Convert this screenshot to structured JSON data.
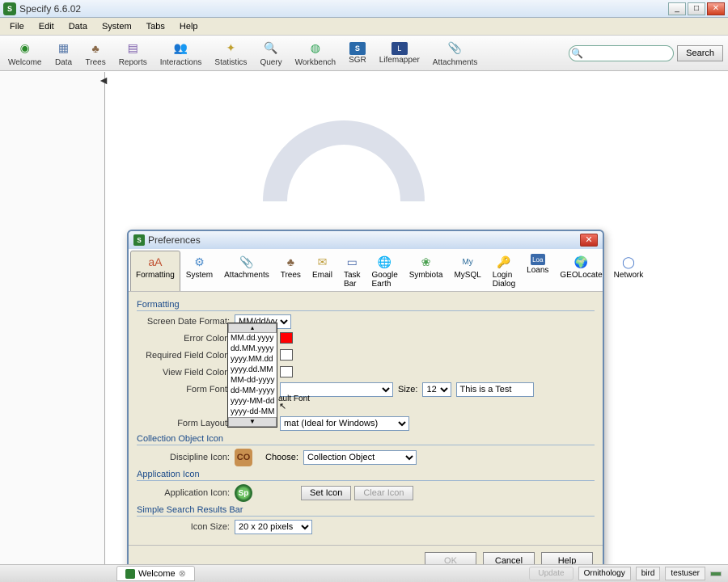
{
  "app": {
    "title": "Specify 6.6.02",
    "icon_initial": "S"
  },
  "menu": {
    "file": "File",
    "edit": "Edit",
    "data": "Data",
    "system": "System",
    "tabs": "Tabs",
    "help": "Help"
  },
  "toolbar": {
    "welcome": "Welcome",
    "data": "Data",
    "trees": "Trees",
    "reports": "Reports",
    "interactions": "Interactions",
    "statistics": "Statistics",
    "query": "Query",
    "workbench": "Workbench",
    "sgr": "SGR",
    "lifemapper": "Lifemapper",
    "attachments": "Attachments",
    "search_placeholder": "",
    "search_button": "Search"
  },
  "dialog": {
    "title": "Preferences",
    "tabs": [
      "Formatting",
      "System",
      "Attachments",
      "Trees",
      "Email",
      "Task Bar",
      "Google Earth",
      "Symbiota",
      "MySQL",
      "Login Dialog",
      "Loans",
      "GEOLocate",
      "Network"
    ],
    "active_tab": "Formatting",
    "section_formatting": "Formatting",
    "screen_date_format_label": "Screen Date Format:",
    "screen_date_format_value": "MM/dd/yyyy",
    "date_options": [
      "MM.dd.yyyy",
      "dd.MM.yyyy",
      "yyyy.MM.dd",
      "yyyy.dd.MM",
      "MM-dd-yyyy",
      "dd-MM-yyyy",
      "yyyy-MM-dd",
      "yyyy-dd-MM"
    ],
    "date_options_more_label": "▼",
    "error_color_label": "Error Color:",
    "error_color_value": "#ff0000",
    "required_field_color_label": "Required Field Color:",
    "required_field_color_value": "#ffffff",
    "view_field_color_label": "View Field Color:",
    "view_field_color_value": "#ffffff",
    "form_font_label": "Form Font:",
    "form_font_value": "",
    "size_label": "Size:",
    "size_value": "12",
    "sample_text": "This is a Test",
    "default_font_fragment": "ault Font",
    "form_layout_label": "Form Layout:",
    "form_layout_value": "mat (Ideal for Windows)",
    "section_collection": "Collection Object Icon",
    "discipline_icon_label": "Discipline Icon:",
    "discipline_icon_text": "CO",
    "choose_label": "Choose:",
    "choose_value": "Collection Object",
    "section_appicon": "Application Icon",
    "application_icon_label": "Application Icon:",
    "set_icon_button": "Set Icon",
    "clear_icon_button": "Clear Icon",
    "section_search": "Simple Search Results Bar",
    "icon_size_label": "Icon Size:",
    "icon_size_value": "20 x 20 pixels",
    "ok": "OK",
    "cancel": "Cancel",
    "help": "Help"
  },
  "statusbar": {
    "welcome_tab": "Welcome",
    "update_button": "Update",
    "item1": "Ornithology",
    "item2": "bird",
    "item3": "testuser"
  }
}
